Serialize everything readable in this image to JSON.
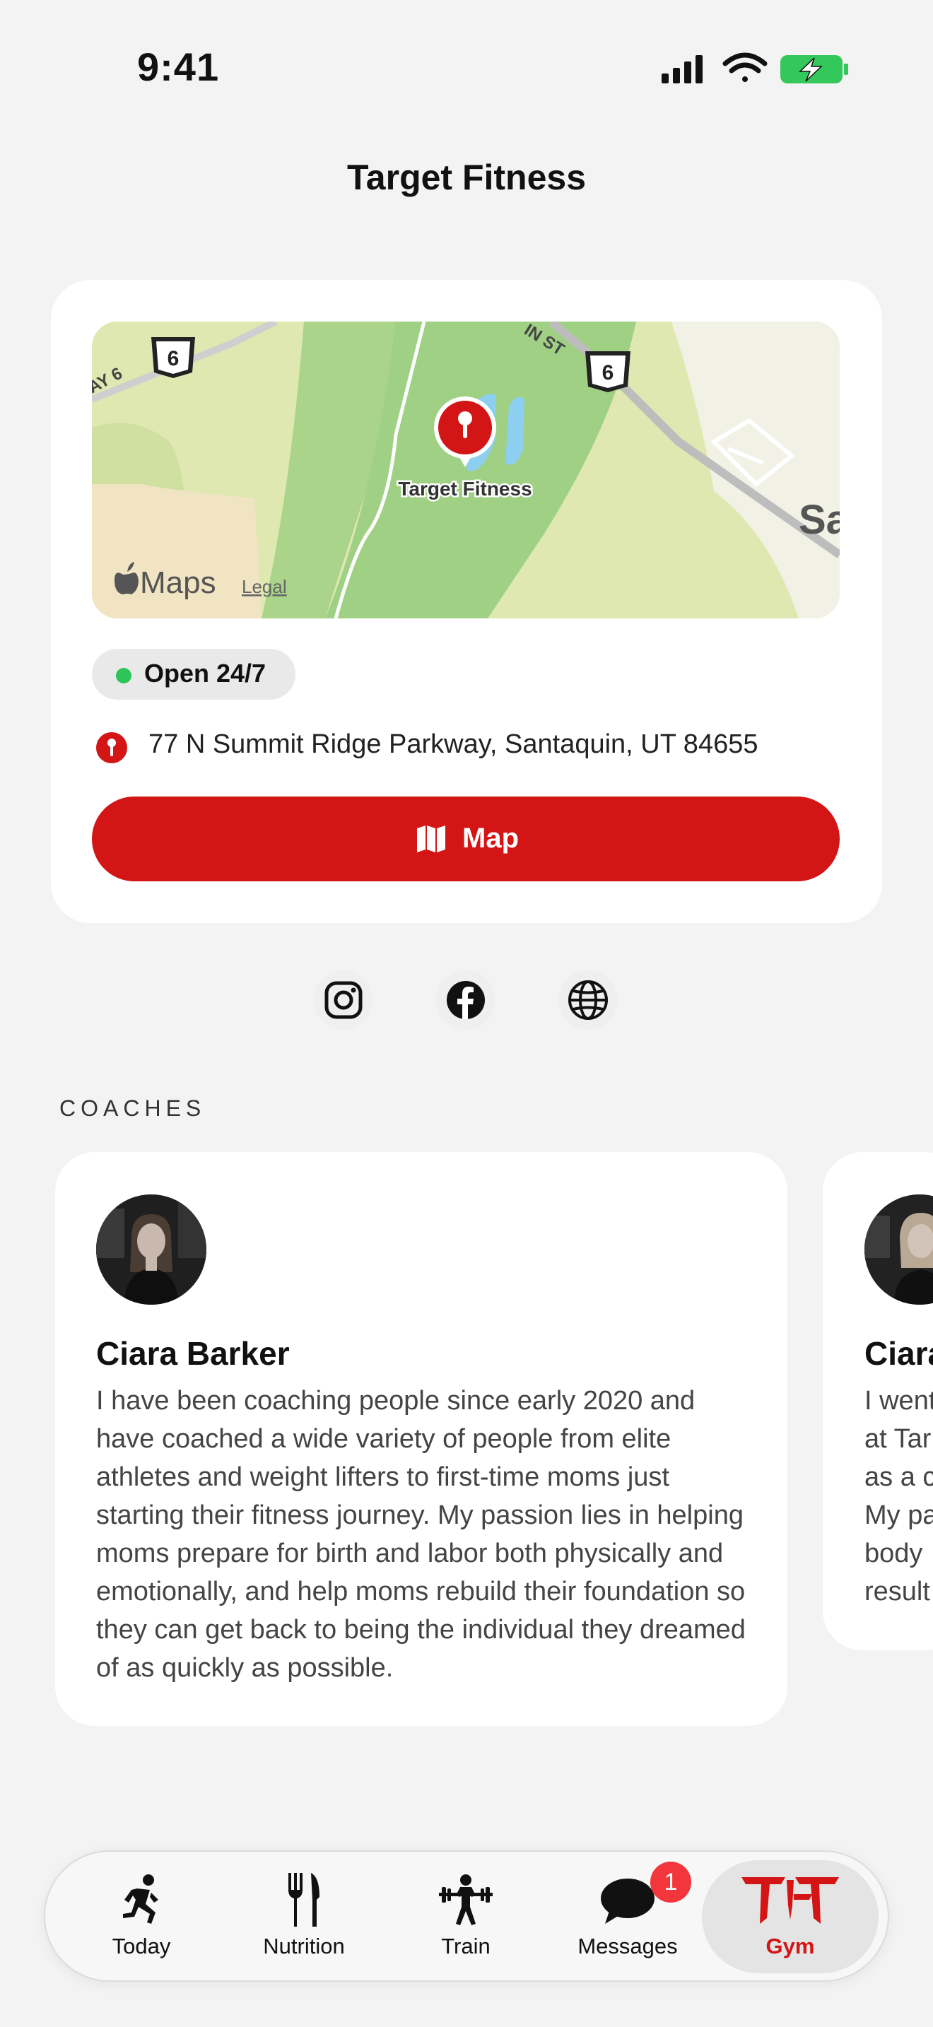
{
  "status_bar": {
    "time": "9:41",
    "icons": [
      "signal-icon",
      "wifi-icon",
      "battery-charging-icon"
    ],
    "battery_color": "#34c759"
  },
  "header": {
    "title": "Target Fitness"
  },
  "location": {
    "map": {
      "pin_label": "Target Fitness",
      "road_labels": [
        "AY 6",
        "IN ST",
        "Sa"
      ],
      "highway_shields": [
        "6",
        "6"
      ],
      "attribution": "Maps",
      "legal_label": "Legal"
    },
    "hours_badge": "Open 24/7",
    "address": "77 N Summit Ridge Parkway, Santaquin, UT 84655",
    "map_button_label": "Map"
  },
  "social": [
    "instagram-icon",
    "facebook-icon",
    "globe-icon"
  ],
  "coaches": {
    "section_title": "COACHES",
    "items": [
      {
        "name": "Ciara Barker",
        "bio": "I have been coaching people since early 2020 and have coached a wide variety of people from elite athletes and weight lifters to first-time moms just starting their fitness journey. My passion lies in helping moms prepare for birth and labor both physically and emotionally, and help moms rebuild their foundation so they can get back to being the individual they dreamed of as quickly as possible."
      },
      {
        "name": "Ciara",
        "bio_lines": [
          "I went",
          "at Tar",
          "as a c",
          "My pa",
          "body",
          "result"
        ]
      }
    ]
  },
  "tab_bar": {
    "tabs": [
      {
        "label": "Today",
        "icon": "running-person-icon"
      },
      {
        "label": "Nutrition",
        "icon": "fork-knife-icon"
      },
      {
        "label": "Train",
        "icon": "weightlifter-icon"
      },
      {
        "label": "Messages",
        "icon": "chat-bubble-icon",
        "badge": "1"
      },
      {
        "label": "Gym",
        "icon": "target-fitness-logo-icon",
        "selected": true
      }
    ],
    "accent_color": "#d31515",
    "badge_color": "#f2363c"
  }
}
